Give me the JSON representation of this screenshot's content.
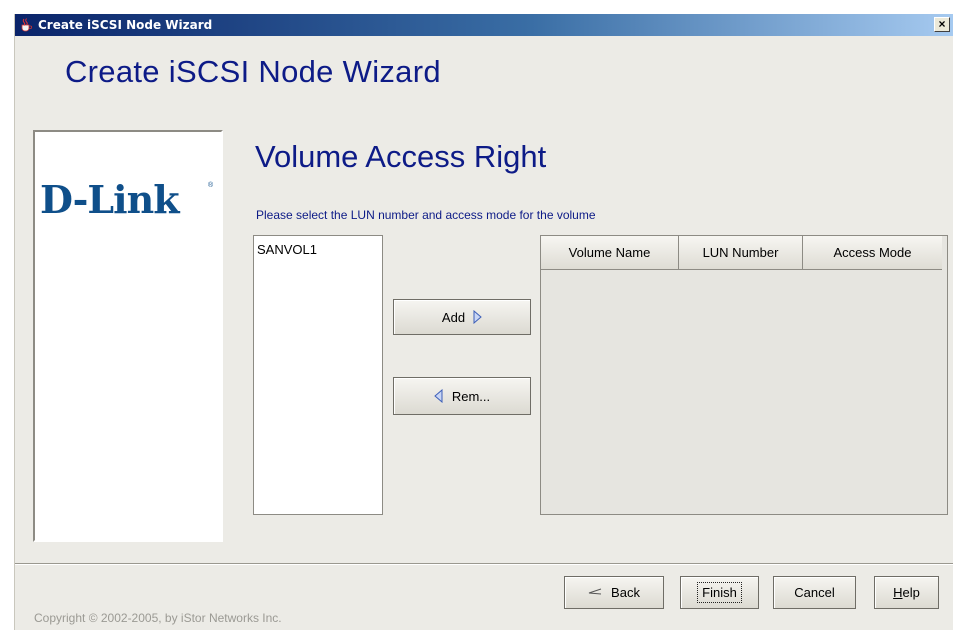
{
  "window": {
    "title": "Create iSCSI Node Wizard",
    "close_label": "×"
  },
  "wizard": {
    "heading": "Create iSCSI Node Wizard"
  },
  "logo": {
    "text": "D-Link",
    "registered": "®"
  },
  "page": {
    "heading": "Volume Access Right",
    "instruction": "Please select the LUN number and access mode for the volume"
  },
  "volume_list": {
    "items": [
      "SANVOL1"
    ]
  },
  "transfer": {
    "add_label": "Add",
    "remove_label": "Rem..."
  },
  "table": {
    "columns": [
      "Volume Name",
      "LUN Number",
      "Access Mode"
    ],
    "rows": []
  },
  "footer": {
    "copyright": "Copyright © 2002-2005, by iStor Networks Inc.",
    "back_label": "Back",
    "finish_label": "Finish",
    "cancel_label": "Cancel",
    "help_first": "H",
    "help_rest": "elp"
  },
  "colors": {
    "heading": "#0d1b87",
    "logo": "#0f4f8a",
    "title_bar_start": "#0a246a",
    "title_bar_end": "#a6caf0",
    "background": "#ecebe6"
  }
}
